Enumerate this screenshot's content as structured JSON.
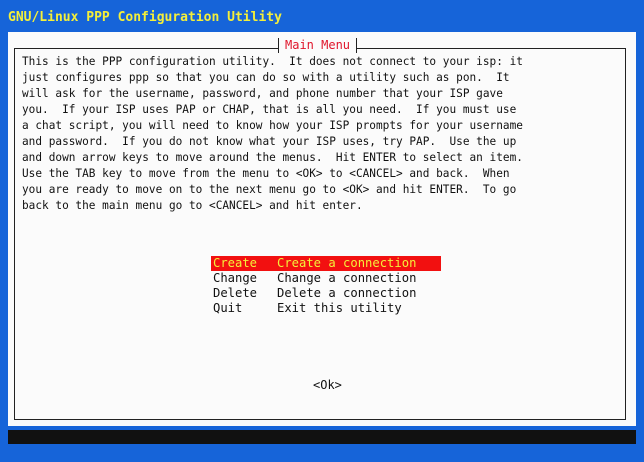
{
  "window": {
    "title": "GNU/Linux PPP Configuration Utility"
  },
  "dialog": {
    "title": "Main Menu",
    "description_lines": [
      "This is the PPP configuration utility.  It does not connect to your isp: it",
      "just configures ppp so that you can do so with a utility such as pon.  It",
      "will ask for the username, password, and phone number that your ISP gave",
      "you.  If your ISP uses PAP or CHAP, that is all you need.  If you must use",
      "a chat script, you will need to know how your ISP prompts for your username",
      "and password.  If you do not know what your ISP uses, try PAP.  Use the up",
      "and down arrow keys to move around the menus.  Hit ENTER to select an item.",
      "Use the TAB key to move from the menu to <OK> to <CANCEL> and back.  When",
      "you are ready to move on to the next menu go to <OK> and hit ENTER.  To go",
      "back to the main menu go to <CANCEL> and hit enter."
    ],
    "menu": [
      {
        "key": "Create",
        "description": "Create a connection",
        "selected": true
      },
      {
        "key": "Change",
        "description": "Change a connection",
        "selected": false
      },
      {
        "key": "Delete",
        "description": "Delete a connection",
        "selected": false
      },
      {
        "key": "Quit",
        "description": "Exit this utility",
        "selected": false
      }
    ],
    "ok_label": "<Ok>"
  },
  "colors": {
    "background": "#1664d9",
    "title_text": "#f4ef3a",
    "dialog_bg": "#fbfbfb",
    "frame_title_text": "#e0152b",
    "selected_bg": "#f21010",
    "selected_text": "#f4ef3a"
  }
}
